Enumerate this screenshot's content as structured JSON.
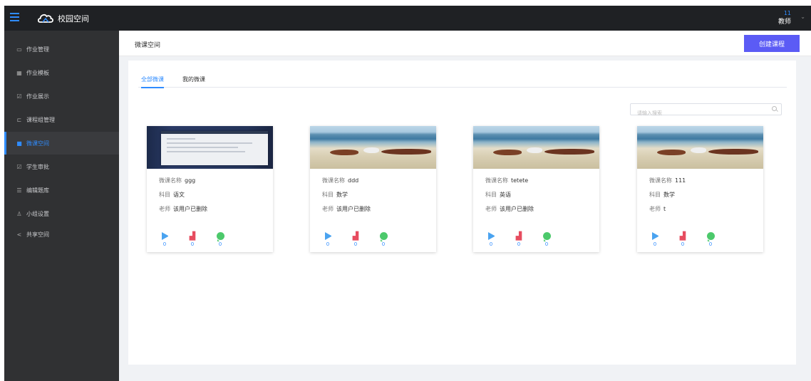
{
  "topbar": {
    "title": "校园空间",
    "user_id": "11",
    "user_role": "教师"
  },
  "sidebar": {
    "items": [
      {
        "icon": "document-icon",
        "label": "作业管理",
        "active": false
      },
      {
        "icon": "grid-icon",
        "label": "作业模板",
        "active": false
      },
      {
        "icon": "check-icon",
        "label": "作业展示",
        "active": false
      },
      {
        "icon": "group-icon",
        "label": "课程组管理",
        "active": false
      },
      {
        "icon": "folder-icon",
        "label": "微课空间",
        "active": true
      },
      {
        "icon": "check-icon",
        "label": "学生审批",
        "active": false
      },
      {
        "icon": "list-icon",
        "label": "编辑题库",
        "active": false
      },
      {
        "icon": "user-icon",
        "label": "小组设置",
        "active": false
      },
      {
        "icon": "share-icon",
        "label": "共享空间",
        "active": false
      }
    ]
  },
  "header": {
    "title": "微课空间",
    "create_label": "创建课程"
  },
  "tabs": [
    {
      "label": "全部微课",
      "active": true
    },
    {
      "label": "我的微课",
      "active": false
    }
  ],
  "search": {
    "placeholder": "请输入搜索"
  },
  "labels": {
    "name": "微课名称",
    "subject": "科目",
    "teacher": "老师"
  },
  "courses": [
    {
      "name": "ggg",
      "subject": "语文",
      "teacher": "该用户已删除",
      "plays": "0",
      "likes": "0",
      "comments": "0",
      "thumb": "screen"
    },
    {
      "name": "ddd",
      "subject": "数学",
      "teacher": "该用户已删除",
      "plays": "0",
      "likes": "0",
      "comments": "0",
      "thumb": "beach"
    },
    {
      "name": "tetete",
      "subject": "英语",
      "teacher": "该用户已删除",
      "plays": "0",
      "likes": "0",
      "comments": "0",
      "thumb": "beach"
    },
    {
      "name": "111",
      "subject": "数学",
      "teacher": "t",
      "plays": "0",
      "likes": "0",
      "comments": "0",
      "thumb": "beach"
    }
  ],
  "colors": {
    "accent": "#2f8cff",
    "button": "#5b5bf5",
    "sidebar": "#303133",
    "topbar": "#1f2124",
    "like": "#e74c5f",
    "comment": "#4cc96b",
    "play": "#4aa3f0"
  }
}
